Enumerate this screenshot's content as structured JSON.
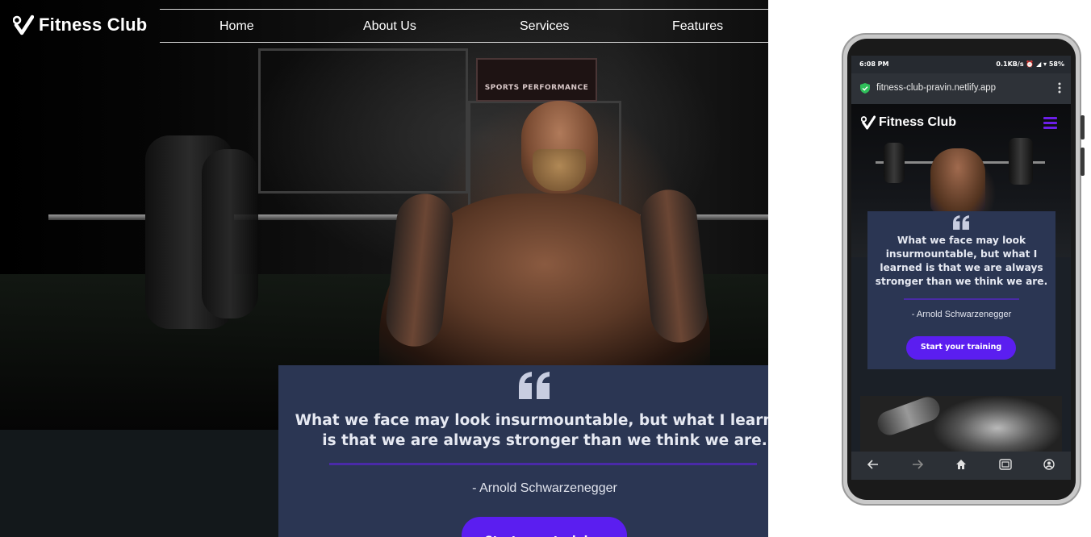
{
  "site": {
    "logo_text": "Fitness Club"
  },
  "nav": {
    "items": [
      {
        "label": "Home"
      },
      {
        "label": "About Us"
      },
      {
        "label": "Services"
      },
      {
        "label": "Features"
      }
    ]
  },
  "hero": {
    "sign_text": "SPORTS PERFORMANCE"
  },
  "quote": {
    "text": "What we face may look insurmountable, but what I learned is that we are always stronger than we think we are.",
    "author": "- Arnold Schwarzenegger",
    "cta_label": "Start your training"
  },
  "mobile": {
    "status_time": "6:08 PM",
    "status_right": "0.1KB/s ⏰ ◢ ▾ 58%",
    "url": "fitness-club-pravin.netlify.app",
    "logo_text": "Fitness Club",
    "quote_text": "What we face may look insurmountable, but what I learned is that we are always stronger than we think we are.",
    "author": "- Arnold Schwarzenegger",
    "cta_label": "Start your training"
  },
  "colors": {
    "accent": "#5b1ef0",
    "card": "#2b3653",
    "divider": "#4a2aa8"
  },
  "icons": {
    "logo": "heart-check-icon",
    "quote": "quote-open-icon",
    "menu": "hamburger-menu-icon",
    "lock": "secure-shield-icon",
    "more": "kebab-menu-icon"
  }
}
